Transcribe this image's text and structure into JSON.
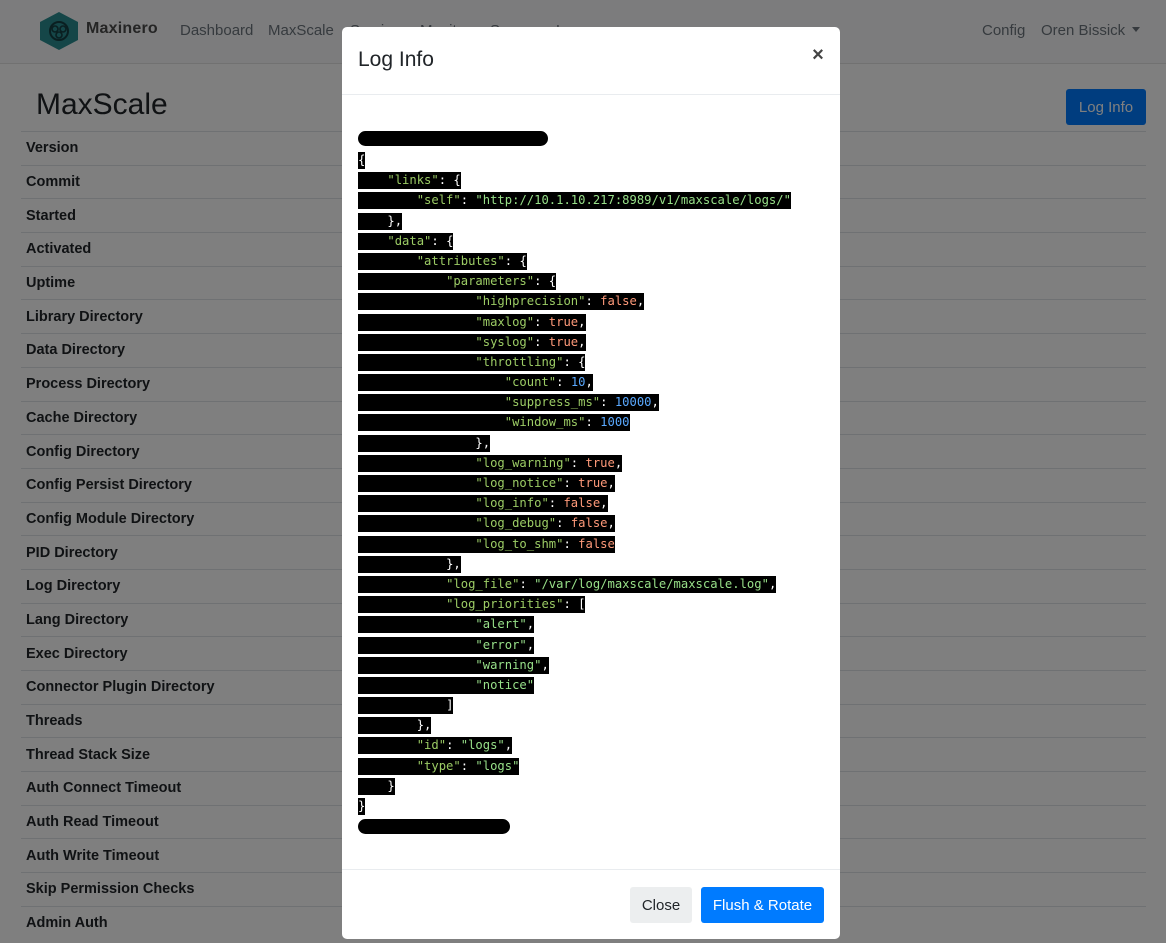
{
  "navbar": {
    "brand": "Maxinero",
    "links": [
      "Dashboard",
      "MaxScale",
      "Services",
      "Monitors",
      "Servers",
      "Logs"
    ],
    "config_label": "Config",
    "user_label": "Oren Bissick"
  },
  "page": {
    "title": "MaxScale",
    "action_label": "Log Info",
    "rows": [
      "Version",
      "Commit",
      "Started",
      "Activated",
      "Uptime",
      "Library Directory",
      "Data Directory",
      "Process Directory",
      "Cache Directory",
      "Config Directory",
      "Config Persist Directory",
      "Config Module Directory",
      "PID Directory",
      "Log Directory",
      "Lang Directory",
      "Exec Directory",
      "Connector Plugin Directory",
      "Threads",
      "Thread Stack Size",
      "Auth Connect Timeout",
      "Auth Read Timeout",
      "Auth Write Timeout",
      "Skip Permission Checks",
      "Admin Auth"
    ]
  },
  "modal": {
    "title": "Log Info",
    "close_icon": "×",
    "close_label": "Close",
    "primary_label": "Flush & Rotate",
    "code_lines": [
      [
        {
          "t": "{",
          "c": "punc"
        }
      ],
      [
        {
          "t": "    ",
          "c": "pad"
        },
        {
          "t": "\"links\"",
          "c": "key"
        },
        {
          "t": ": {",
          "c": "punc"
        }
      ],
      [
        {
          "t": "        ",
          "c": "pad"
        },
        {
          "t": "\"self\"",
          "c": "key"
        },
        {
          "t": ": ",
          "c": "punc"
        },
        {
          "t": "\"http://10.1.10.217:8989/v1/maxscale/logs/\"",
          "c": "str"
        }
      ],
      [
        {
          "t": "    ",
          "c": "pad"
        },
        {
          "t": "},",
          "c": "punc"
        }
      ],
      [
        {
          "t": "    ",
          "c": "pad"
        },
        {
          "t": "\"data\"",
          "c": "key"
        },
        {
          "t": ": {",
          "c": "punc"
        }
      ],
      [
        {
          "t": "        ",
          "c": "pad"
        },
        {
          "t": "\"attributes\"",
          "c": "key"
        },
        {
          "t": ": {",
          "c": "punc"
        }
      ],
      [
        {
          "t": "            ",
          "c": "pad"
        },
        {
          "t": "\"parameters\"",
          "c": "key"
        },
        {
          "t": ": {",
          "c": "punc"
        }
      ],
      [
        {
          "t": "                ",
          "c": "pad"
        },
        {
          "t": "\"highprecision\"",
          "c": "key"
        },
        {
          "t": ": ",
          "c": "punc"
        },
        {
          "t": "false",
          "c": "bool"
        },
        {
          "t": ",",
          "c": "punc"
        }
      ],
      [
        {
          "t": "                ",
          "c": "pad"
        },
        {
          "t": "\"maxlog\"",
          "c": "key"
        },
        {
          "t": ": ",
          "c": "punc"
        },
        {
          "t": "true",
          "c": "bool"
        },
        {
          "t": ",",
          "c": "punc"
        }
      ],
      [
        {
          "t": "                ",
          "c": "pad"
        },
        {
          "t": "\"syslog\"",
          "c": "key"
        },
        {
          "t": ": ",
          "c": "punc"
        },
        {
          "t": "true",
          "c": "bool"
        },
        {
          "t": ",",
          "c": "punc"
        }
      ],
      [
        {
          "t": "                ",
          "c": "pad"
        },
        {
          "t": "\"throttling\"",
          "c": "key"
        },
        {
          "t": ": {",
          "c": "punc"
        }
      ],
      [
        {
          "t": "                    ",
          "c": "pad"
        },
        {
          "t": "\"count\"",
          "c": "key"
        },
        {
          "t": ": ",
          "c": "punc"
        },
        {
          "t": "10",
          "c": "num"
        },
        {
          "t": ",",
          "c": "punc"
        }
      ],
      [
        {
          "t": "                    ",
          "c": "pad"
        },
        {
          "t": "\"suppress_ms\"",
          "c": "key"
        },
        {
          "t": ": ",
          "c": "punc"
        },
        {
          "t": "10000",
          "c": "num"
        },
        {
          "t": ",",
          "c": "punc"
        }
      ],
      [
        {
          "t": "                    ",
          "c": "pad"
        },
        {
          "t": "\"window_ms\"",
          "c": "key"
        },
        {
          "t": ": ",
          "c": "punc"
        },
        {
          "t": "1000",
          "c": "num"
        }
      ],
      [
        {
          "t": "                ",
          "c": "pad"
        },
        {
          "t": "},",
          "c": "punc"
        }
      ],
      [
        {
          "t": "                ",
          "c": "pad"
        },
        {
          "t": "\"log_warning\"",
          "c": "key"
        },
        {
          "t": ": ",
          "c": "punc"
        },
        {
          "t": "true",
          "c": "bool"
        },
        {
          "t": ",",
          "c": "punc"
        }
      ],
      [
        {
          "t": "                ",
          "c": "pad"
        },
        {
          "t": "\"log_notice\"",
          "c": "key"
        },
        {
          "t": ": ",
          "c": "punc"
        },
        {
          "t": "true",
          "c": "bool"
        },
        {
          "t": ",",
          "c": "punc"
        }
      ],
      [
        {
          "t": "                ",
          "c": "pad"
        },
        {
          "t": "\"log_info\"",
          "c": "key"
        },
        {
          "t": ": ",
          "c": "punc"
        },
        {
          "t": "false",
          "c": "bool"
        },
        {
          "t": ",",
          "c": "punc"
        }
      ],
      [
        {
          "t": "                ",
          "c": "pad"
        },
        {
          "t": "\"log_debug\"",
          "c": "key"
        },
        {
          "t": ": ",
          "c": "punc"
        },
        {
          "t": "false",
          "c": "bool"
        },
        {
          "t": ",",
          "c": "punc"
        }
      ],
      [
        {
          "t": "                ",
          "c": "pad"
        },
        {
          "t": "\"log_to_shm\"",
          "c": "key"
        },
        {
          "t": ": ",
          "c": "punc"
        },
        {
          "t": "false",
          "c": "bool"
        }
      ],
      [
        {
          "t": "            ",
          "c": "pad"
        },
        {
          "t": "},",
          "c": "punc"
        }
      ],
      [
        {
          "t": "            ",
          "c": "pad"
        },
        {
          "t": "\"log_file\"",
          "c": "key"
        },
        {
          "t": ": ",
          "c": "punc"
        },
        {
          "t": "\"/var/log/maxscale/maxscale.log\"",
          "c": "str"
        },
        {
          "t": ",",
          "c": "punc"
        }
      ],
      [
        {
          "t": "            ",
          "c": "pad"
        },
        {
          "t": "\"log_priorities\"",
          "c": "key"
        },
        {
          "t": ": [",
          "c": "punc"
        }
      ],
      [
        {
          "t": "                ",
          "c": "pad"
        },
        {
          "t": "\"alert\"",
          "c": "str"
        },
        {
          "t": ",",
          "c": "punc"
        }
      ],
      [
        {
          "t": "                ",
          "c": "pad"
        },
        {
          "t": "\"error\"",
          "c": "str"
        },
        {
          "t": ",",
          "c": "punc"
        }
      ],
      [
        {
          "t": "                ",
          "c": "pad"
        },
        {
          "t": "\"warning\"",
          "c": "str"
        },
        {
          "t": ",",
          "c": "punc"
        }
      ],
      [
        {
          "t": "                ",
          "c": "pad"
        },
        {
          "t": "\"notice\"",
          "c": "str"
        }
      ],
      [
        {
          "t": "            ",
          "c": "pad"
        },
        {
          "t": "]",
          "c": "punc"
        }
      ],
      [
        {
          "t": "        ",
          "c": "pad"
        },
        {
          "t": "},",
          "c": "punc"
        }
      ],
      [
        {
          "t": "        ",
          "c": "pad"
        },
        {
          "t": "\"id\"",
          "c": "key"
        },
        {
          "t": ": ",
          "c": "punc"
        },
        {
          "t": "\"logs\"",
          "c": "str"
        },
        {
          "t": ",",
          "c": "punc"
        }
      ],
      [
        {
          "t": "        ",
          "c": "pad"
        },
        {
          "t": "\"type\"",
          "c": "key"
        },
        {
          "t": ": ",
          "c": "punc"
        },
        {
          "t": "\"logs\"",
          "c": "str"
        }
      ],
      [
        {
          "t": "    ",
          "c": "pad"
        },
        {
          "t": "}",
          "c": "punc"
        }
      ],
      [
        {
          "t": "}",
          "c": "punc"
        }
      ]
    ]
  },
  "colors": {
    "primary": "#007bff",
    "backdrop": "rgba(0,0,0,0.5)",
    "logo": "#2a8c91"
  }
}
